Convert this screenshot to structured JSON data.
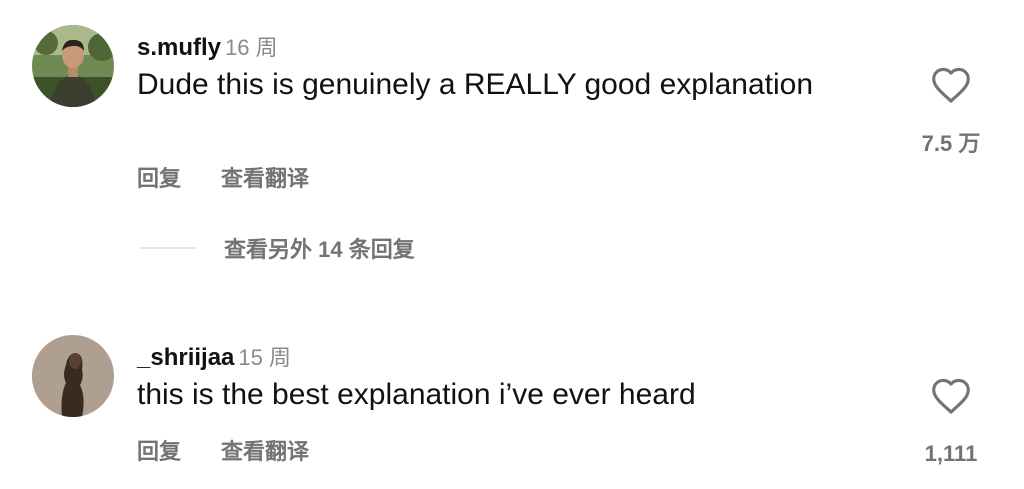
{
  "comments": [
    {
      "username": "s.mufly",
      "time": "16 周",
      "text": "Dude this is genuinely a REALLY good explanation",
      "actions": {
        "reply": "回复",
        "translate": "查看翻译"
      },
      "like_count": "7.5 万",
      "avatar_icon": "avatar-man-outdoors"
    },
    {
      "username": "_shriijaa",
      "time": "15 周",
      "text": "this is the best explanation i’ve ever heard",
      "actions": {
        "reply": "回复",
        "translate": "查看翻译"
      },
      "like_count": "1,111",
      "avatar_icon": "avatar-woman-silhouette"
    }
  ],
  "view_replies": {
    "label": "查看另外 14 条回复"
  },
  "colors": {
    "text": "#111111",
    "secondary": "#737373",
    "timestamp": "#8a8a8a",
    "divider": "#e6e6e6"
  }
}
